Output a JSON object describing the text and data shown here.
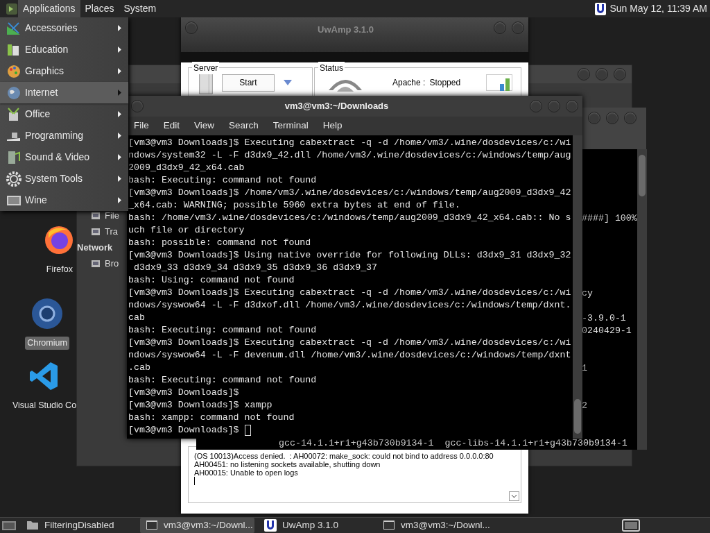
{
  "top_panel": {
    "menus": [
      {
        "label": "Applications",
        "selected": true
      },
      {
        "label": "Places",
        "selected": false
      },
      {
        "label": "System",
        "selected": false
      }
    ],
    "clock": "Sun May 12, 11:39 AM"
  },
  "applications_menu": {
    "items": [
      {
        "label": "Accessories",
        "selected": false
      },
      {
        "label": "Education",
        "selected": false
      },
      {
        "label": "Graphics",
        "selected": false
      },
      {
        "label": "Internet",
        "selected": true
      },
      {
        "label": "Office",
        "selected": false
      },
      {
        "label": "Programming",
        "selected": false
      },
      {
        "label": "Sound & Video",
        "selected": false
      },
      {
        "label": "System Tools",
        "selected": false
      },
      {
        "label": "Wine",
        "selected": false
      }
    ]
  },
  "desktop_icons": [
    {
      "label": "Firefox",
      "selected": false
    },
    {
      "label": "Chromium",
      "selected": true
    },
    {
      "label": "Visual Studio Co",
      "selected": false
    }
  ],
  "file_window": {
    "sidebar": [
      {
        "label": "File",
        "kind": "item"
      },
      {
        "label": "Tra",
        "kind": "item"
      },
      {
        "label": "Network",
        "kind": "heading"
      },
      {
        "label": "Bro",
        "kind": "item"
      }
    ]
  },
  "uwamp": {
    "title": "UwAmp 3.1.0",
    "server_label": "Server",
    "start_button": "Start",
    "status_label": "Status",
    "apache_label": "Apache :",
    "apache_status": "Stopped",
    "log": [
      "(OS 10013)Access denied.  : AH00072: make_sock: could not bind to address 0.0.0.0:80",
      "AH00451: no listening sockets available, shutting down",
      "AH00015: Unable to open logs"
    ]
  },
  "back_terminal": {
    "lines": [
      "####] 100%",
      "cy",
      "-3.9.0-1",
      "0240429-1",
      "1",
      "2",
      "gcc-14.1.1+r1+g43b730b9134-1  gcc-libs-14.1.1+r1+g43b730b9134-1"
    ]
  },
  "terminal": {
    "title": "vm3@vm3:~/Downloads",
    "menu": [
      "File",
      "Edit",
      "View",
      "Search",
      "Terminal",
      "Help"
    ],
    "lines": [
      "[vm3@vm3 Downloads]$ Executing cabextract -q -d /home/vm3/.wine/dosdevices/c:/wi",
      "ndows/system32 -L -F d3dx9_42.dll /home/vm3/.wine/dosdevices/c:/windows/temp/aug",
      "2009_d3dx9_42_x64.cab",
      "bash: Executing: command not found",
      "[vm3@vm3 Downloads]$ /home/vm3/.wine/dosdevices/c:/windows/temp/aug2009_d3dx9_42",
      "_x64.cab: WARNING; possible 5960 extra bytes at end of file.",
      "bash: /home/vm3/.wine/dosdevices/c:/windows/temp/aug2009_d3dx9_42_x64.cab:: No s",
      "uch file or directory",
      "bash: possible: command not found",
      "[vm3@vm3 Downloads]$ Using native override for following DLLs: d3dx9_31 d3dx9_32",
      " d3dx9_33 d3dx9_34 d3dx9_35 d3dx9_36 d3dx9_37",
      "bash: Using: command not found",
      "[vm3@vm3 Downloads]$ Executing cabextract -q -d /home/vm3/.wine/dosdevices/c:/wi",
      "ndows/syswow64 -L -F d3dxof.dll /home/vm3/.wine/dosdevices/c:/windows/temp/dxnt.",
      "cab",
      "bash: Executing: command not found",
      "[vm3@vm3 Downloads]$ Executing cabextract -q -d /home/vm3/.wine/dosdevices/c:/wi",
      "ndows/syswow64 -L -F devenum.dll /home/vm3/.wine/dosdevices/c:/windows/temp/dxnt",
      ".cab",
      "bash: Executing: command not found",
      "[vm3@vm3 Downloads]$",
      "[vm3@vm3 Downloads]$ xampp",
      "bash: xampp: command not found",
      "[vm3@vm3 Downloads]$ "
    ]
  },
  "taskbar": {
    "tasks": [
      {
        "label": "FilteringDisabled",
        "kind": "folder",
        "selected": false
      },
      {
        "label": "vm3@vm3:~/Downl...",
        "kind": "terminal",
        "selected": true
      },
      {
        "label": "UwAmp 3.1.0",
        "kind": "uwamp",
        "selected": false
      },
      {
        "label": "vm3@vm3:~/Downl...",
        "kind": "terminal",
        "selected": false
      }
    ]
  }
}
